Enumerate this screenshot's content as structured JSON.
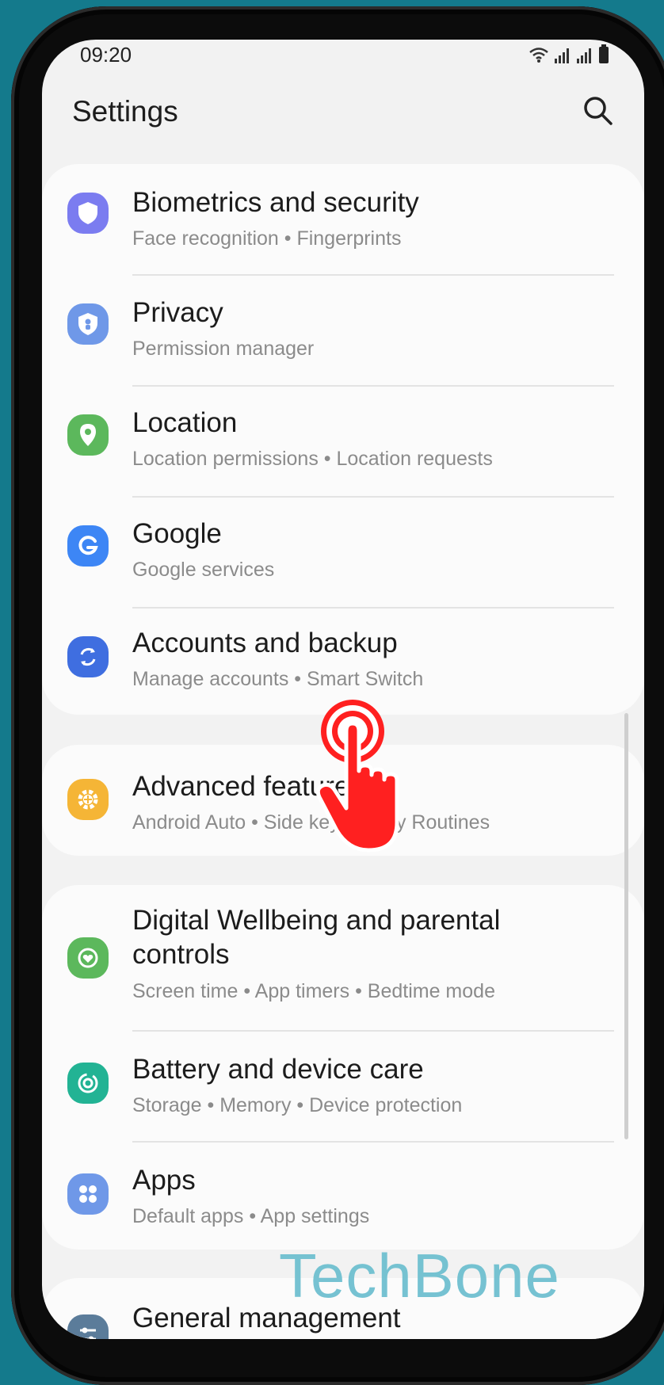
{
  "status_bar": {
    "time": "09:20"
  },
  "header": {
    "title": "Settings"
  },
  "items": [
    {
      "title": "Biometrics and security",
      "subtitle": "Face recognition  •  Fingerprints",
      "icon": "shield-icon",
      "color": "#7b7cf0"
    },
    {
      "title": "Privacy",
      "subtitle": "Permission manager",
      "icon": "privacy-shield-icon",
      "color": "#6f98e8"
    },
    {
      "title": "Location",
      "subtitle": "Location permissions  •  Location requests",
      "icon": "location-pin-icon",
      "color": "#5cb85c"
    },
    {
      "title": "Google",
      "subtitle": "Google services",
      "icon": "google-g-icon",
      "color": "#3d86f5"
    },
    {
      "title": "Accounts and backup",
      "subtitle": "Manage accounts  •  Smart Switch",
      "icon": "sync-icon",
      "color": "#3f6ee0"
    },
    {
      "title": "Advanced features",
      "subtitle": "Android Auto  •  Side key  •  Bixby Routines",
      "icon": "gear-plus-icon",
      "color": "#f5b536"
    },
    {
      "title": "Digital Wellbeing and parental controls",
      "title_line1": "Digital Wellbeing and parental",
      "title_line2": "controls",
      "subtitle": "Screen time  •  App timers  •  Bedtime mode",
      "icon": "wellbeing-heart-icon",
      "color": "#5cb85c"
    },
    {
      "title": "Battery and device care",
      "subtitle": "Storage  •  Memory  •  Device protection",
      "icon": "device-care-icon",
      "color": "#22b394"
    },
    {
      "title": "Apps",
      "subtitle": "Default apps  •  App settings",
      "icon": "apps-grid-icon",
      "color": "#6f98e8"
    },
    {
      "title": "General management",
      "icon": "sliders-icon",
      "color": "#5b7c9a"
    }
  ],
  "watermark": "TechBone"
}
